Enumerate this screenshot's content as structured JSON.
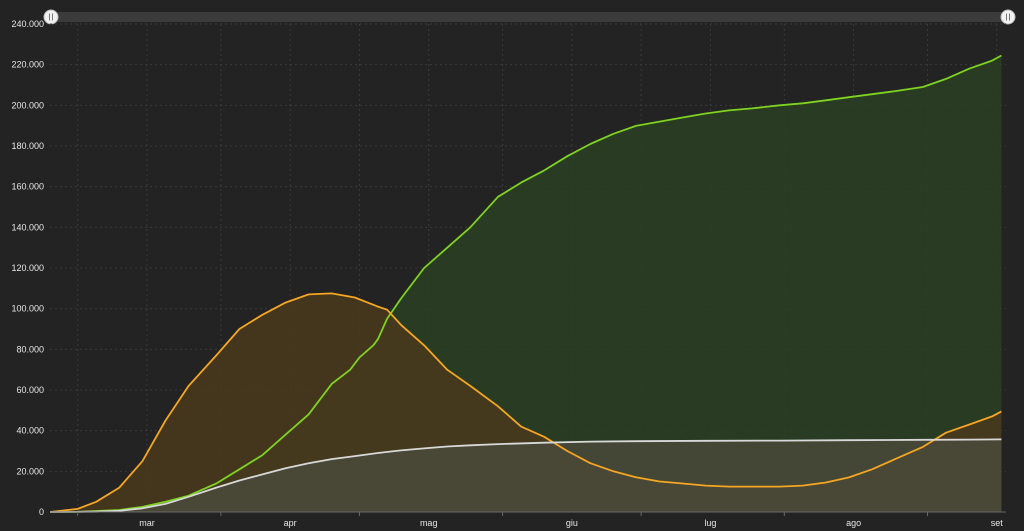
{
  "chart_data": {
    "type": "area",
    "ylim": [
      0,
      240000
    ],
    "y_ticks": [
      {
        "value": 0,
        "label": "0"
      },
      {
        "value": 20000,
        "label": "20.000"
      },
      {
        "value": 40000,
        "label": "40.000"
      },
      {
        "value": 60000,
        "label": "60.000"
      },
      {
        "value": 80000,
        "label": "80.000"
      },
      {
        "value": 100000,
        "label": "100.000"
      },
      {
        "value": 120000,
        "label": "120.000"
      },
      {
        "value": 140000,
        "label": "140.000"
      },
      {
        "value": 160000,
        "label": "160.000"
      },
      {
        "value": 180000,
        "label": "180.000"
      },
      {
        "value": 200000,
        "label": "200.000"
      },
      {
        "value": 220000,
        "label": "220.000"
      },
      {
        "value": 240000,
        "label": "240.000"
      }
    ],
    "xlim": [
      "2020-02-24",
      "2020-09-18"
    ],
    "x_month_starts": [
      "2020-03-01",
      "2020-04-01",
      "2020-05-01",
      "2020-06-01",
      "2020-07-01",
      "2020-08-01",
      "2020-09-01",
      "2020-10-01"
    ],
    "month_labels": [
      {
        "date": "2020-03-16",
        "label": "mar"
      },
      {
        "date": "2020-04-16",
        "label": "apr"
      },
      {
        "date": "2020-05-16",
        "label": "mag"
      },
      {
        "date": "2020-06-16",
        "label": "giu"
      },
      {
        "date": "2020-07-16",
        "label": "lug"
      },
      {
        "date": "2020-08-16",
        "label": "ago"
      },
      {
        "date": "2020-09-16",
        "label": "set"
      }
    ],
    "grid": true,
    "series": [
      {
        "color": "#7ed321",
        "fill": "#2a3f22",
        "points": [
          [
            "2020-02-24",
            0
          ],
          [
            "2020-03-01",
            100
          ],
          [
            "2020-03-05",
            500
          ],
          [
            "2020-03-10",
            1000
          ],
          [
            "2020-03-15",
            2500
          ],
          [
            "2020-03-20",
            5000
          ],
          [
            "2020-03-25",
            8000
          ],
          [
            "2020-03-31",
            14000
          ],
          [
            "2020-04-05",
            21000
          ],
          [
            "2020-04-10",
            28000
          ],
          [
            "2020-04-15",
            38000
          ],
          [
            "2020-04-20",
            48000
          ],
          [
            "2020-04-25",
            63000
          ],
          [
            "2020-04-29",
            70000
          ],
          [
            "2020-05-01",
            76000
          ],
          [
            "2020-05-04",
            82000
          ],
          [
            "2020-05-05",
            85000
          ],
          [
            "2020-05-07",
            95000
          ],
          [
            "2020-05-10",
            105000
          ],
          [
            "2020-05-15",
            120000
          ],
          [
            "2020-05-20",
            130000
          ],
          [
            "2020-05-25",
            140000
          ],
          [
            "2020-05-31",
            155000
          ],
          [
            "2020-06-05",
            162000
          ],
          [
            "2020-06-10",
            168000
          ],
          [
            "2020-06-15",
            175000
          ],
          [
            "2020-06-20",
            181000
          ],
          [
            "2020-06-25",
            186000
          ],
          [
            "2020-06-30",
            190000
          ],
          [
            "2020-07-05",
            192000
          ],
          [
            "2020-07-10",
            194000
          ],
          [
            "2020-07-15",
            196000
          ],
          [
            "2020-07-20",
            197500
          ],
          [
            "2020-07-25",
            198500
          ],
          [
            "2020-07-31",
            200000
          ],
          [
            "2020-08-05",
            201000
          ],
          [
            "2020-08-10",
            202500
          ],
          [
            "2020-08-15",
            204000
          ],
          [
            "2020-08-20",
            205500
          ],
          [
            "2020-08-25",
            207000
          ],
          [
            "2020-08-31",
            209000
          ],
          [
            "2020-09-05",
            213000
          ],
          [
            "2020-09-10",
            218000
          ],
          [
            "2020-09-15",
            222000
          ],
          [
            "2020-09-17",
            224500
          ]
        ]
      },
      {
        "color": "#f5a623",
        "fill": "#4a3a1c",
        "points": [
          [
            "2020-02-24",
            0
          ],
          [
            "2020-03-01",
            1500
          ],
          [
            "2020-03-05",
            5000
          ],
          [
            "2020-03-10",
            12000
          ],
          [
            "2020-03-15",
            25000
          ],
          [
            "2020-03-20",
            45000
          ],
          [
            "2020-03-25",
            62000
          ],
          [
            "2020-03-31",
            77000
          ],
          [
            "2020-04-05",
            90000
          ],
          [
            "2020-04-10",
            97000
          ],
          [
            "2020-04-15",
            103000
          ],
          [
            "2020-04-20",
            107000
          ],
          [
            "2020-04-25",
            107500
          ],
          [
            "2020-04-30",
            105500
          ],
          [
            "2020-05-05",
            101000
          ],
          [
            "2020-05-07",
            99500
          ],
          [
            "2020-05-10",
            92000
          ],
          [
            "2020-05-15",
            82000
          ],
          [
            "2020-05-20",
            70000
          ],
          [
            "2020-05-25",
            62000
          ],
          [
            "2020-05-31",
            52000
          ],
          [
            "2020-06-05",
            42000
          ],
          [
            "2020-06-10",
            37000
          ],
          [
            "2020-06-15",
            30000
          ],
          [
            "2020-06-20",
            24000
          ],
          [
            "2020-06-25",
            20000
          ],
          [
            "2020-06-30",
            17000
          ],
          [
            "2020-07-05",
            15000
          ],
          [
            "2020-07-10",
            14000
          ],
          [
            "2020-07-15",
            13000
          ],
          [
            "2020-07-20",
            12500
          ],
          [
            "2020-07-25",
            12500
          ],
          [
            "2020-07-31",
            12500
          ],
          [
            "2020-08-05",
            13000
          ],
          [
            "2020-08-10",
            14500
          ],
          [
            "2020-08-15",
            17000
          ],
          [
            "2020-08-20",
            21000
          ],
          [
            "2020-08-25",
            26000
          ],
          [
            "2020-08-31",
            32000
          ],
          [
            "2020-09-05",
            39000
          ],
          [
            "2020-09-10",
            43000
          ],
          [
            "2020-09-15",
            47000
          ],
          [
            "2020-09-17",
            49500
          ]
        ]
      },
      {
        "color": "#d8d8d8",
        "fill": "#4a4a3a",
        "points": [
          [
            "2020-02-24",
            0
          ],
          [
            "2020-03-01",
            30
          ],
          [
            "2020-03-05",
            150
          ],
          [
            "2020-03-10",
            600
          ],
          [
            "2020-03-15",
            1800
          ],
          [
            "2020-03-20",
            4000
          ],
          [
            "2020-03-25",
            7500
          ],
          [
            "2020-03-31",
            12000
          ],
          [
            "2020-04-05",
            15500
          ],
          [
            "2020-04-10",
            18500
          ],
          [
            "2020-04-15",
            21500
          ],
          [
            "2020-04-20",
            24000
          ],
          [
            "2020-04-25",
            26000
          ],
          [
            "2020-04-30",
            27500
          ],
          [
            "2020-05-05",
            29000
          ],
          [
            "2020-05-10",
            30300
          ],
          [
            "2020-05-15",
            31300
          ],
          [
            "2020-05-20",
            32200
          ],
          [
            "2020-05-25",
            32800
          ],
          [
            "2020-05-31",
            33400
          ],
          [
            "2020-06-10",
            34100
          ],
          [
            "2020-06-20",
            34600
          ],
          [
            "2020-06-30",
            34800
          ],
          [
            "2020-07-15",
            35000
          ],
          [
            "2020-07-31",
            35100
          ],
          [
            "2020-08-15",
            35300
          ],
          [
            "2020-08-31",
            35500
          ],
          [
            "2020-09-10",
            35600
          ],
          [
            "2020-09-17",
            35700
          ]
        ]
      }
    ]
  }
}
